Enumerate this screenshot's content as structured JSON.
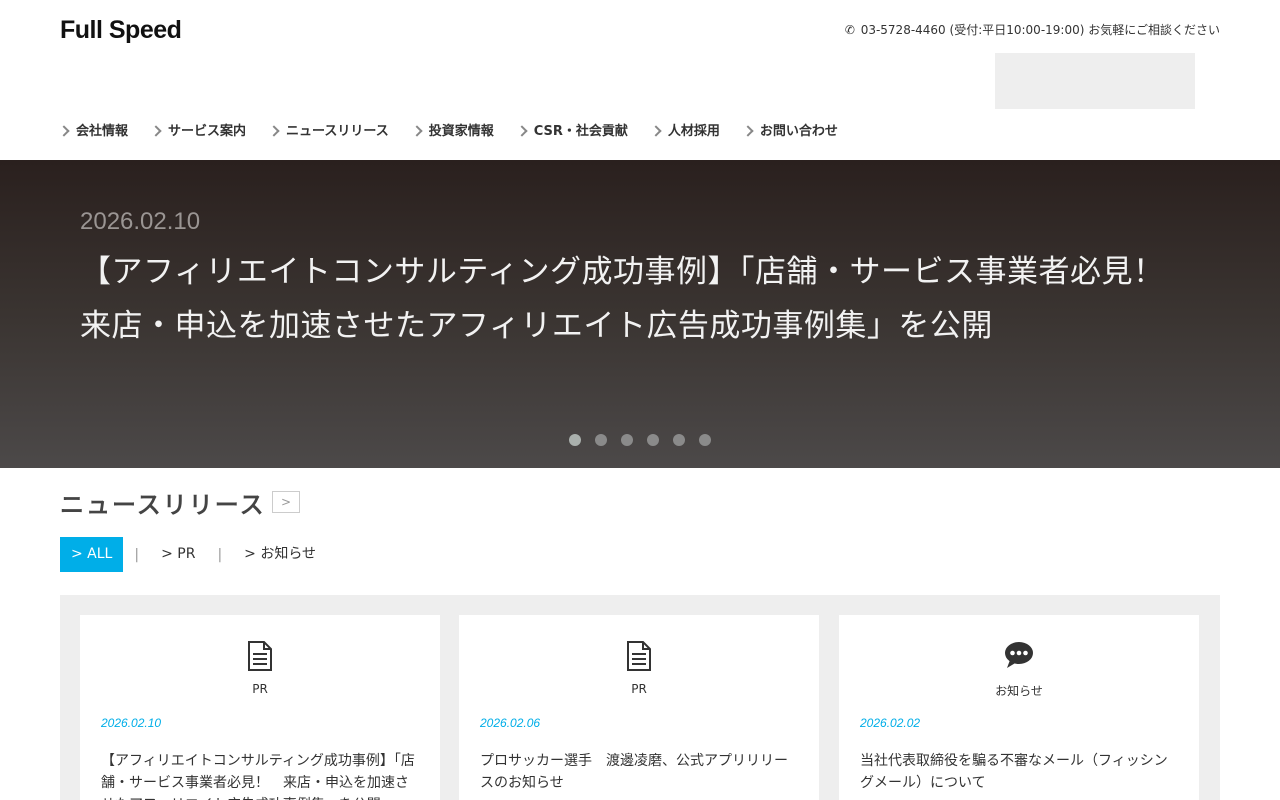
{
  "header": {
    "logo": "Full Speed",
    "phone": "03-5728-4460 (受付:平日10:00-19:00) お気軽にご相談ください"
  },
  "nav": [
    {
      "label": "会社情報"
    },
    {
      "label": "サービス案内"
    },
    {
      "label": "ニュースリリース"
    },
    {
      "label": "投資家情報"
    },
    {
      "label": "CSR・社会貢献"
    },
    {
      "label": "人材採用"
    },
    {
      "label": "お問い合わせ"
    }
  ],
  "hero": {
    "date": "2026.02.10",
    "title": "【アフィリエイトコンサルティング成功事例】「店舗・サービス事業者必見！　来店・申込を加速させたアフィリエイト広告成功事例集」を公開",
    "slide_count": 6,
    "active_slide": 1
  },
  "news": {
    "section_title": "ニュースリリース",
    "more_label": ">",
    "filters": [
      {
        "label": "> ALL"
      },
      {
        "label": "> PR"
      },
      {
        "label": "> お知らせ"
      }
    ],
    "separator": "|",
    "cards": [
      {
        "icon": "document-icon",
        "category": "PR",
        "date": "2026.02.10",
        "title": "【アフィリエイトコンサルティング成功事例】「店舗・サービス事業者必見！　来店・申込を加速させたアフィリエイト広告成功事例集」を公開"
      },
      {
        "icon": "document-icon",
        "category": "PR",
        "date": "2026.02.06",
        "title": "プロサッカー選手　渡邊凌磨、公式アプリリリースのお知らせ"
      },
      {
        "icon": "chat-bubble-icon",
        "category": "お知らせ",
        "date": "2026.02.02",
        "title": "当社代表取締役を騙る不審なメール（フィッシングメール）について"
      }
    ]
  },
  "colors": {
    "accent": "#00aee8",
    "hero_top": "#2a201e",
    "hero_bottom": "#4c4949"
  }
}
